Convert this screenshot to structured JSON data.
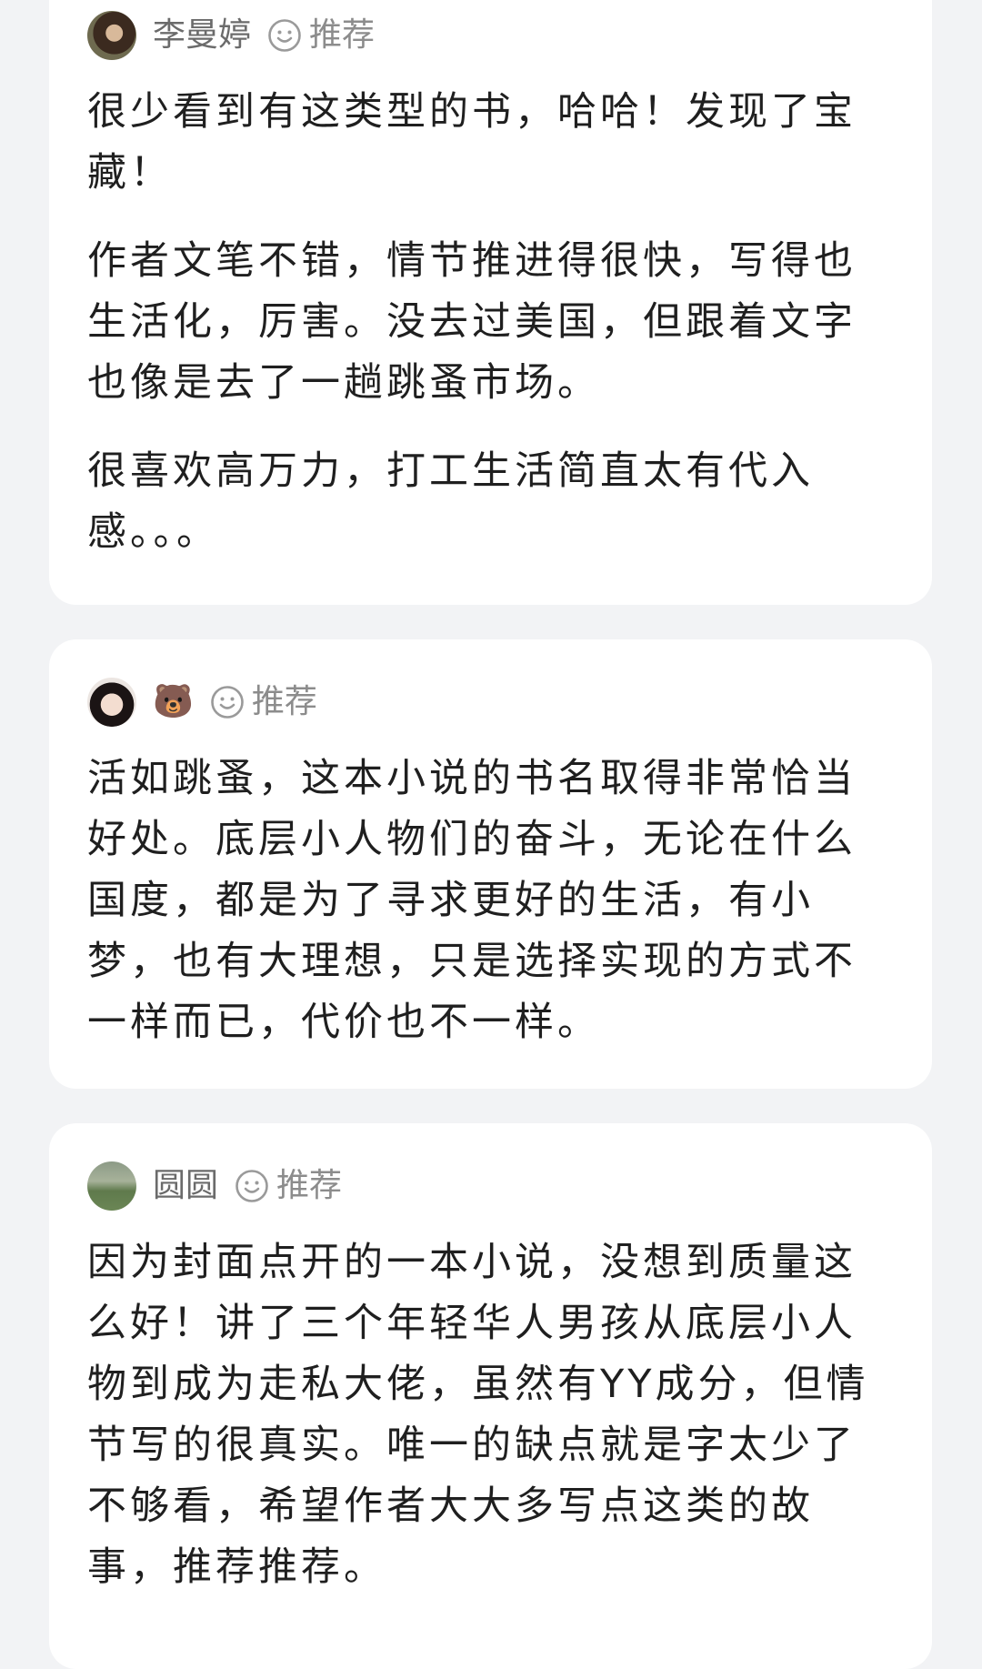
{
  "rec_label": "推荐",
  "comments": [
    {
      "user": "李曼婷",
      "paragraphs": [
        "很少看到有这类型的书，哈哈！发现了宝藏！",
        "作者文笔不错，情节推进得很快，写得也生活化，厉害。没去过美国，但跟着文字也像是去了一趟跳蚤市场。",
        "很喜欢高万力，打工生活简直太有代入感。。。"
      ]
    },
    {
      "user": "🐻",
      "paragraphs": [
        "活如跳蚤，这本小说的书名取得非常恰当好处。底层小人物们的奋斗，无论在什么国度，都是为了寻求更好的生活，有小梦，也有大理想，只是选择实现的方式不一样而已，代价也不一样。"
      ]
    },
    {
      "user": "圆圆",
      "paragraphs": [
        "因为封面点开的一本小说，没想到质量这么好！讲了三个年轻华人男孩从底层小人物到成为走私大佬，虽然有YY成分，但情节写的很真实。唯一的缺点就是字太少了不够看，希望作者大大多写点这类的故事，推荐推荐。"
      ]
    }
  ],
  "colors": {
    "background": "#f2f3f5",
    "card": "#ffffff",
    "text": "#1f1f1f",
    "muted": "#8c8c8c"
  }
}
